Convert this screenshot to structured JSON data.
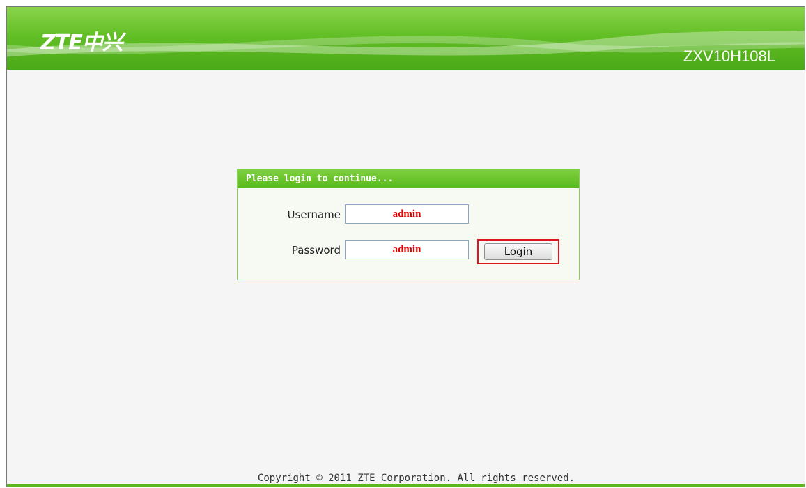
{
  "header": {
    "logo_text": "ZTE中兴",
    "model": "ZXV10H108L",
    "accent_color": "#5ab91c"
  },
  "login": {
    "title": "Please login to continue...",
    "username_label": "Username",
    "username_value": "admin",
    "password_label": "Password",
    "password_value": "admin",
    "login_button": "Login"
  },
  "footer": {
    "copyright": "Copyright © 2011 ZTE Corporation. All rights reserved."
  }
}
